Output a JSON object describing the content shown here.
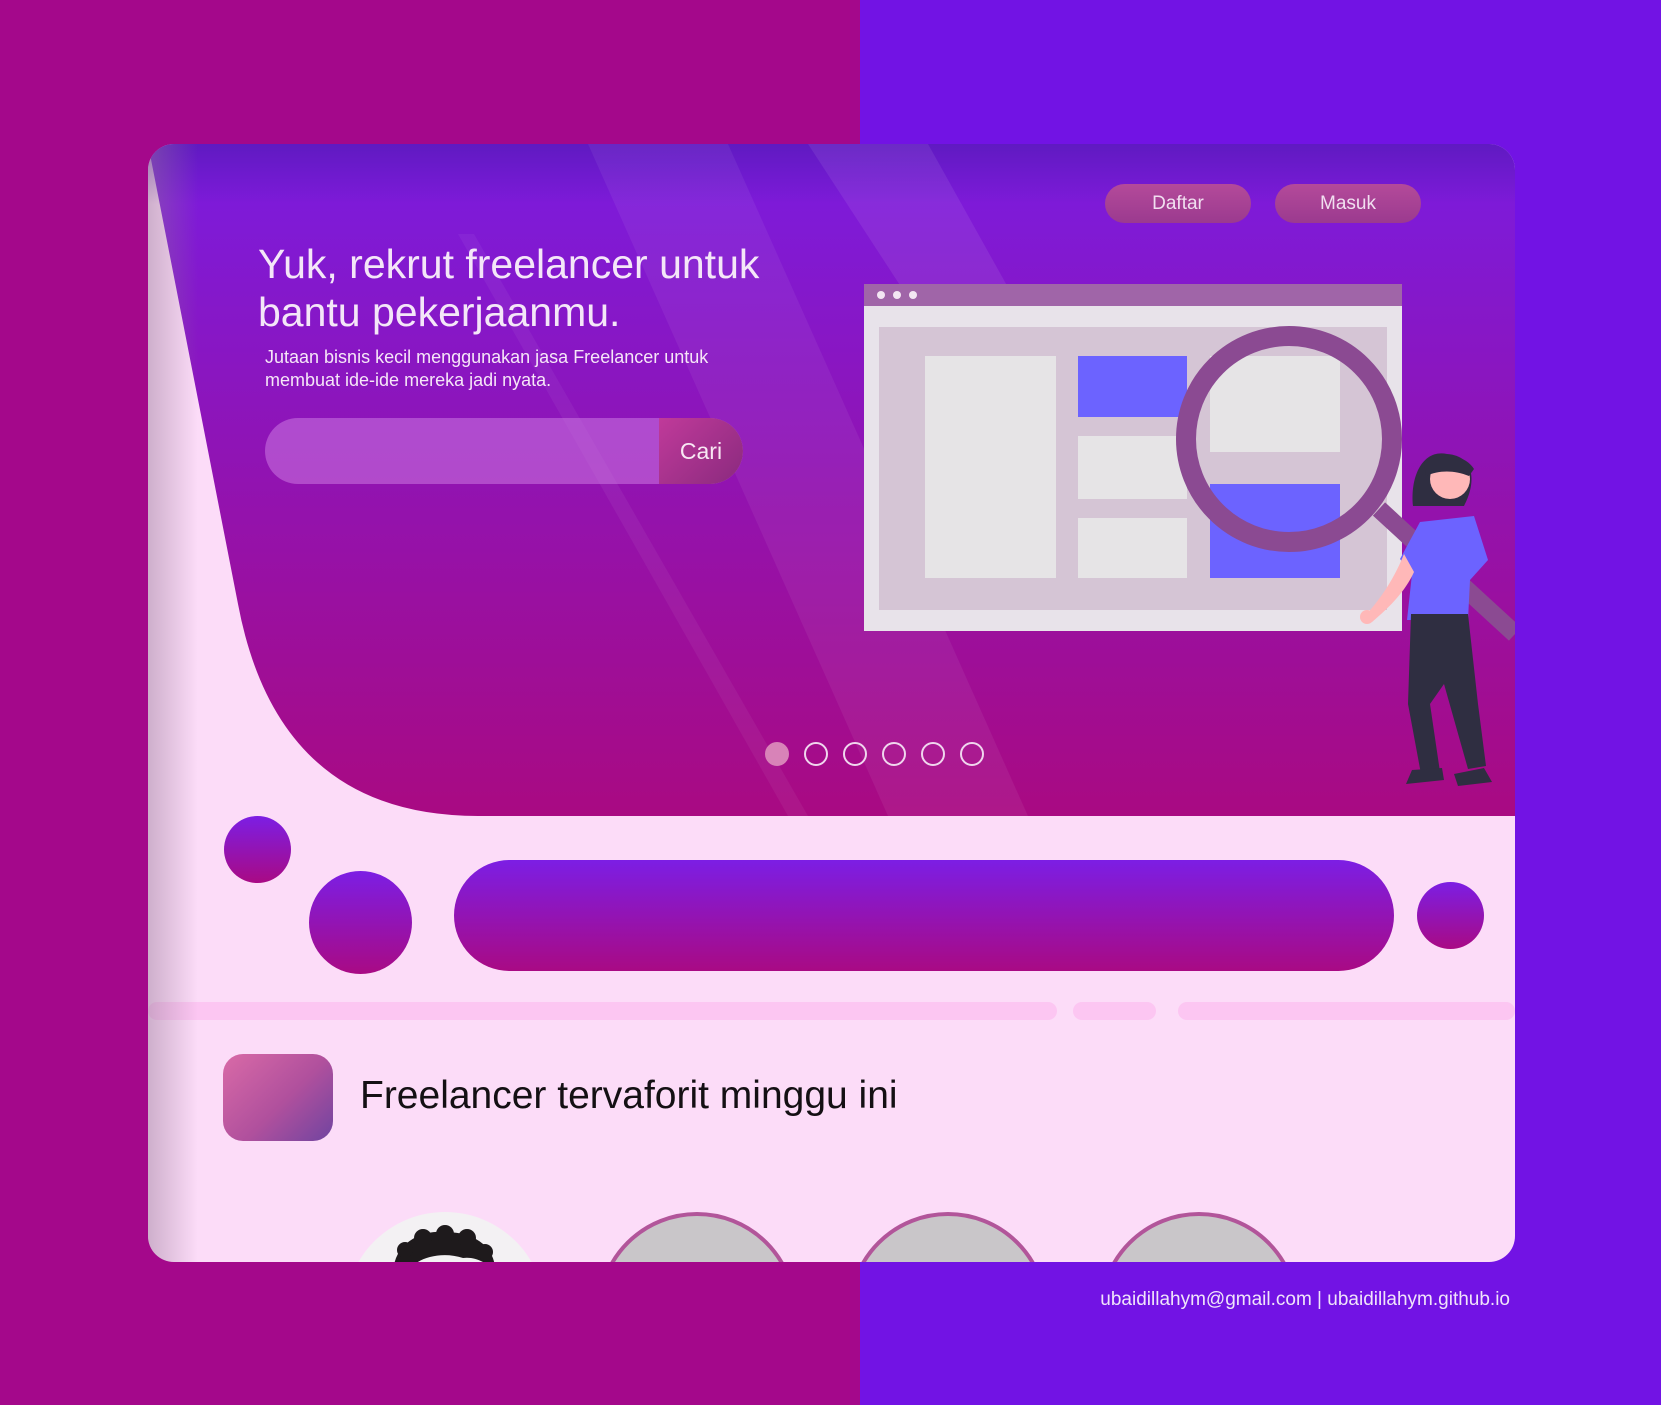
{
  "colors": {
    "left_bg": "#a4088b",
    "right_bg": "#7213e4",
    "card_bg": "#fcdcf8",
    "accent_blue": "#6c63ff",
    "button_pink": "#b44a9a"
  },
  "nav": {
    "register_label": "Daftar",
    "login_label": "Masuk"
  },
  "hero": {
    "title": "Yuk, rekrut freelancer untuk\n bantu pekerjaanmu.",
    "subtitle": "Jutaan bisnis kecil menggunakan jasa Freelancer untuk membuat ide-ide mereka jadi nyata.",
    "search": {
      "value": "",
      "button_label": "Cari"
    },
    "carousel": {
      "count": 6,
      "active_index": 0
    }
  },
  "section": {
    "title": "Freelancer tervaforit minggu ini"
  },
  "footer": {
    "text": "ubaidillahym@gmail.com | ubaidillahym.github.io"
  }
}
